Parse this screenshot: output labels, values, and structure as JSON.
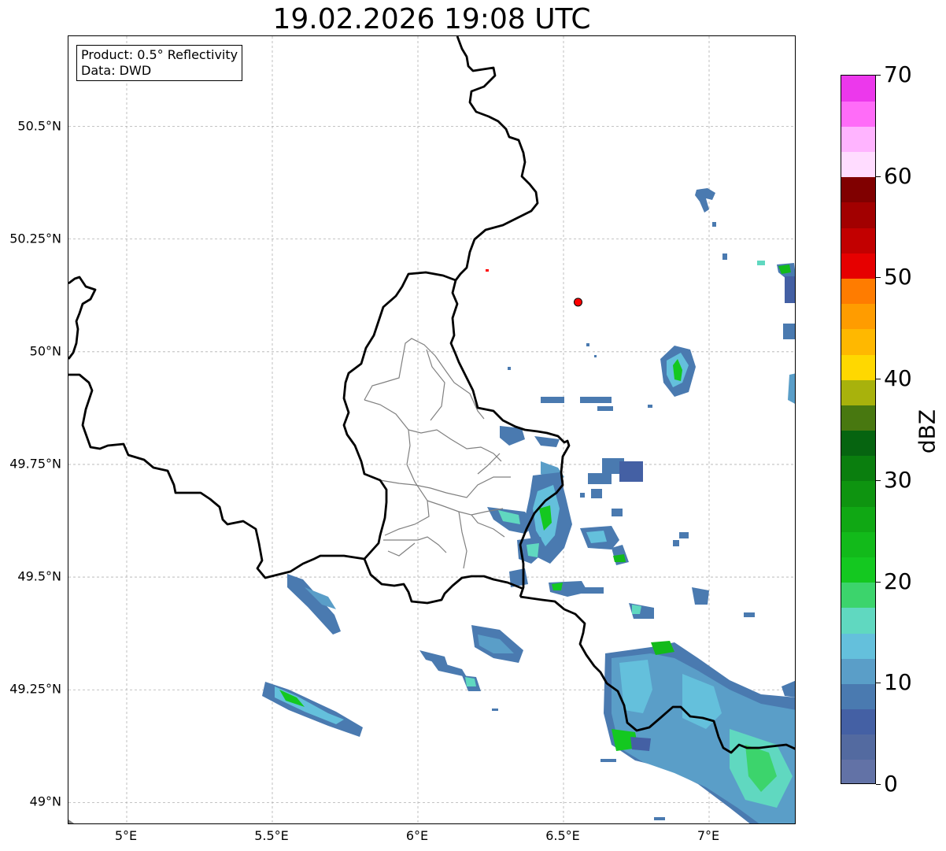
{
  "title": "19.02.2026 19:08 UTC",
  "info": {
    "product": "Product: 0.5° Reflectivity",
    "data": "Data: DWD"
  },
  "map": {
    "lon_range": [
      4.8,
      7.3
    ],
    "lat_range": [
      48.95,
      50.7
    ],
    "gridlines": true,
    "lat_ticks": [
      {
        "value": 49.0,
        "label": "49°N"
      },
      {
        "value": 49.25,
        "label": "49.25°N"
      },
      {
        "value": 49.5,
        "label": "49.5°N"
      },
      {
        "value": 49.75,
        "label": "49.75°N"
      },
      {
        "value": 50.0,
        "label": "50°N"
      },
      {
        "value": 50.25,
        "label": "50.25°N"
      },
      {
        "value": 50.5,
        "label": "50.5°N"
      }
    ],
    "lon_ticks": [
      {
        "value": 5.0,
        "label": "5°E"
      },
      {
        "value": 5.5,
        "label": "5.5°E"
      },
      {
        "value": 6.0,
        "label": "6°E"
      },
      {
        "value": 6.5,
        "label": "6.5°E"
      },
      {
        "value": 7.0,
        "label": "7°E"
      }
    ],
    "radar_site": {
      "lon": 6.55,
      "lat": 50.11,
      "color": "#ff0000"
    },
    "colors": {
      "grid": "#b0b0b0",
      "border": "#000000",
      "admin": "#808080"
    }
  },
  "colorbar": {
    "unit": "dBZ",
    "min": 0,
    "max": 70,
    "tick_labels": [
      "0",
      "10",
      "20",
      "30",
      "40",
      "50",
      "60",
      "70"
    ],
    "tick_values": [
      0,
      10,
      20,
      30,
      40,
      50,
      60,
      70
    ],
    "colors": [
      "#6272a6",
      "#536aa0",
      "#4460a4",
      "#4a7ab0",
      "#5a9ec8",
      "#64c0dc",
      "#60d8c0",
      "#3cd46c",
      "#14c820",
      "#12ba1a",
      "#10a814",
      "#0e9410",
      "#0a7e0e",
      "#066410",
      "#487810",
      "#a8b20c",
      "#ffd800",
      "#ffb800",
      "#ff9c00",
      "#ff7c00",
      "#e60000",
      "#c20000",
      "#a20000",
      "#800000",
      "#ffdcff",
      "#ffb4ff",
      "#ff6cf8",
      "#ec38ec"
    ]
  }
}
